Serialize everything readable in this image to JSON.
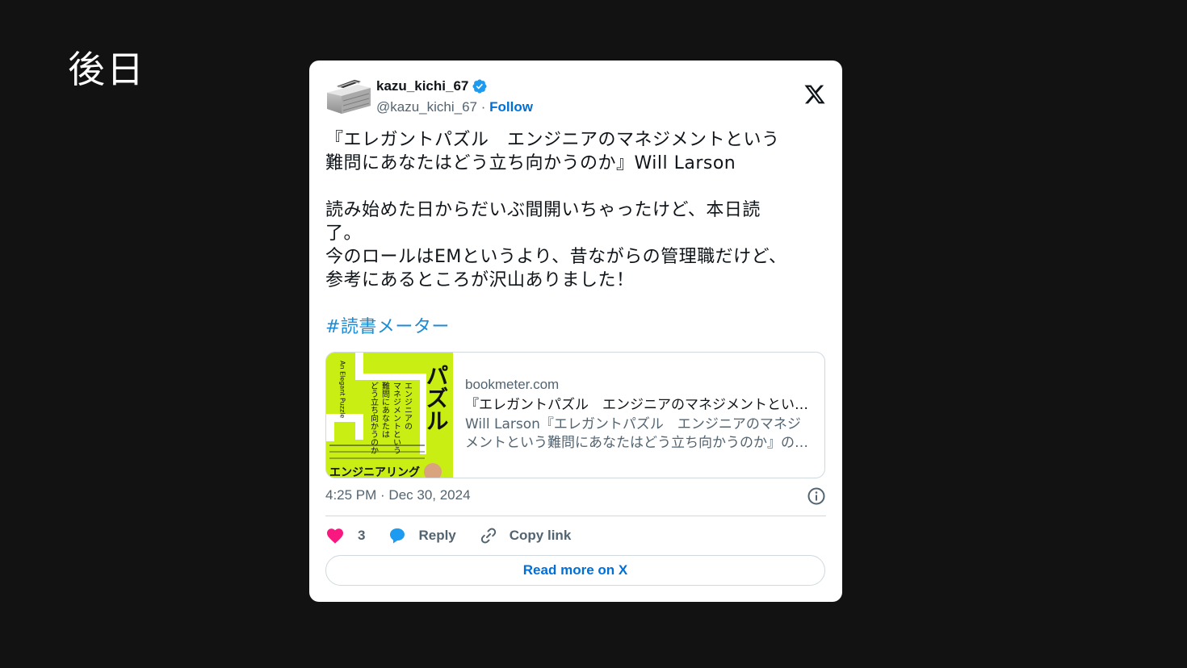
{
  "slide": {
    "title": "後日"
  },
  "tweet": {
    "display_name": "kazu_kichi_67",
    "handle": "@kazu_kichi_67",
    "separator": "·",
    "follow_label": "Follow",
    "text_lines_1": [
      "『エレガントパズル　エンジニアのマネジメントという",
      "難問にあなたはどう立ち向かうのか』Will Larson"
    ],
    "text_lines_2": [
      "読み始めた日からだいぶ間開いちゃったけど、本日読",
      "了。",
      "今のロールはEMというより、昔ながらの管理職だけど、",
      "参考にあるところが沢山ありました！"
    ],
    "hashtag": "#読書メーター",
    "timestamp": "4:25 PM · Dec 30, 2024",
    "like_count": "3",
    "reply_label": "Reply",
    "copy_link_label": "Copy link",
    "read_more_label": "Read more on X"
  },
  "link_card": {
    "domain": "bookmeter.com",
    "title": "『エレガントパズル　エンジニアのマネジメントという難問にあなたはどう立ち向かうのか』の感想",
    "description": "Will Larson『エレガントパズル　エンジニアのマネジメントという難問にあなたはどう立ち向かうのか』の感想・レビュー"
  },
  "book_cover": {
    "big_title": "パズル",
    "vertical_lines": [
      "エンジニアの",
      "マネジメントという",
      "難問にあなたは",
      "どう立ち向かうのか"
    ],
    "english": "An Elegant Puzzle",
    "footer": "エンジニアリング"
  },
  "colors": {
    "background": "#121212",
    "card": "#ffffff",
    "link": "#006fd6",
    "hashtag": "#1d8bd4",
    "like": "#f91880",
    "reply": "#1d9bf0",
    "verified": "#1d9bf0",
    "cover": "#c9ee14"
  },
  "icons": [
    "verified-badge-icon",
    "x-logo-icon",
    "info-icon",
    "heart-icon",
    "reply-bubble-icon",
    "link-icon"
  ]
}
